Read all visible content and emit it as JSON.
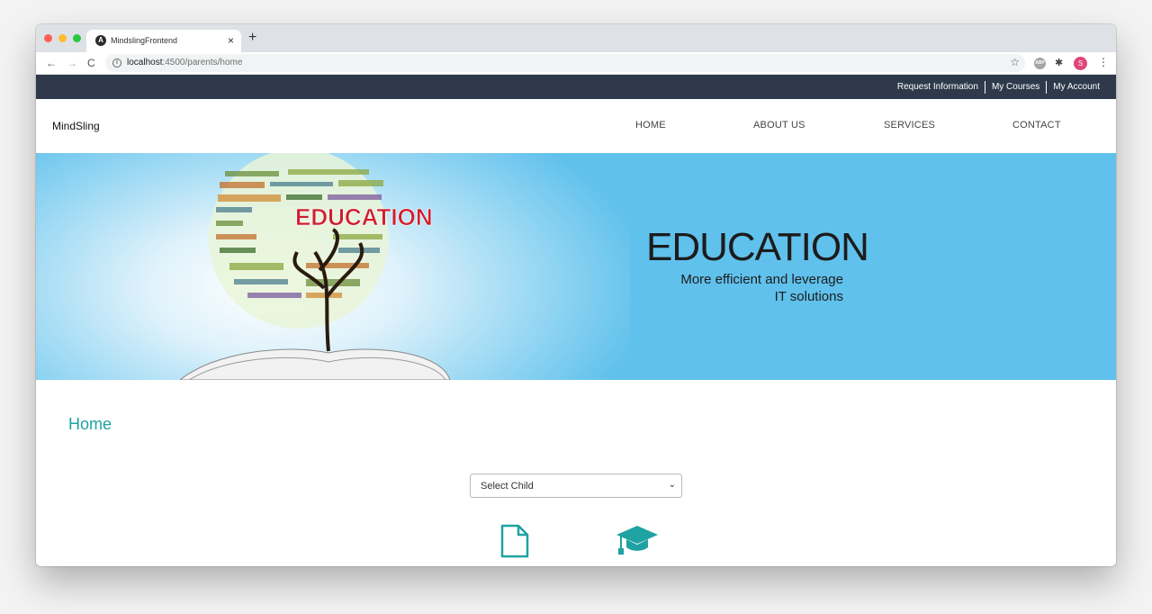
{
  "browser": {
    "tab_title": "MindslingFrontend",
    "favicon_letter": "A",
    "close_glyph": "×",
    "new_tab_glyph": "+",
    "nav": {
      "back": "←",
      "forward": "→",
      "reload": "C"
    },
    "url_host": "localhost",
    "url_path": ":4500/parents/home",
    "bookmark_glyph": "☆",
    "extensions": {
      "abp_label": "ABP",
      "puzzle": "✱",
      "avatar_letter": "S",
      "menu": "⋮"
    },
    "traffic_light_colors": [
      "#ff5f57",
      "#febc2e",
      "#28c840"
    ]
  },
  "topbar": {
    "links": [
      "Request Information",
      "My Courses",
      "My Account"
    ],
    "background": "#2e3a4b"
  },
  "nav": {
    "brand": "MindSling",
    "items": [
      "HOME",
      "ABOUT US",
      "SERVICES",
      "CONTACT"
    ]
  },
  "hero": {
    "title": "EDUCATION",
    "subtitle_line1": "More efficient and leverage",
    "subtitle_line2": "IT solutions",
    "image_word": "EDUCATION",
    "background": "#60c1ec"
  },
  "main": {
    "heading": "Home",
    "heading_color": "#1fa2a2",
    "child_select": {
      "selected": "Select Child"
    },
    "icons": [
      "document-icon",
      "graduation-cap-icon"
    ]
  }
}
